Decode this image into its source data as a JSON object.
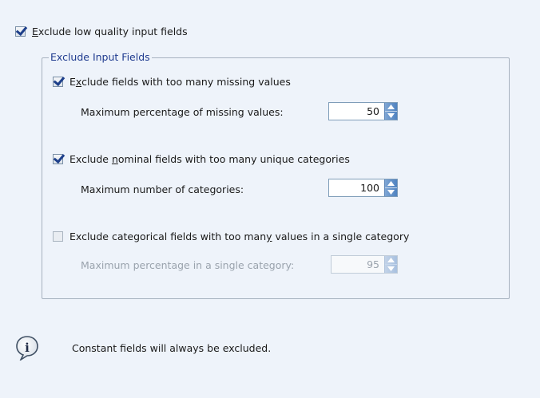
{
  "main_option": {
    "label": "Exclude low quality input fields",
    "checked": true,
    "mnemonic": "E"
  },
  "group": {
    "title": "Exclude Input Fields",
    "missing": {
      "label": "Exclude fields with too many missing values",
      "mnemonic_char": "x",
      "checked": true,
      "sub_label": "Maximum percentage of missing values:",
      "value": "50"
    },
    "nominal": {
      "label": "Exclude nominal fields with too many unique categories",
      "mnemonic_char": "n",
      "checked": true,
      "sub_label": "Maximum number of categories:",
      "value": "100"
    },
    "categorical": {
      "label": "Exclude categorical fields with too many values in a single category",
      "mnemonic_char": "y",
      "checked": false,
      "sub_label": "Maximum percentage in a single category:",
      "value": "95"
    }
  },
  "info": {
    "text": "Constant fields will always be excluded.",
    "icon": "info-icon"
  },
  "colors": {
    "background": "#eef3fa",
    "group_title": "#1f3b8f",
    "check": "#1d3f8a",
    "spinner": "#4f82c0"
  }
}
